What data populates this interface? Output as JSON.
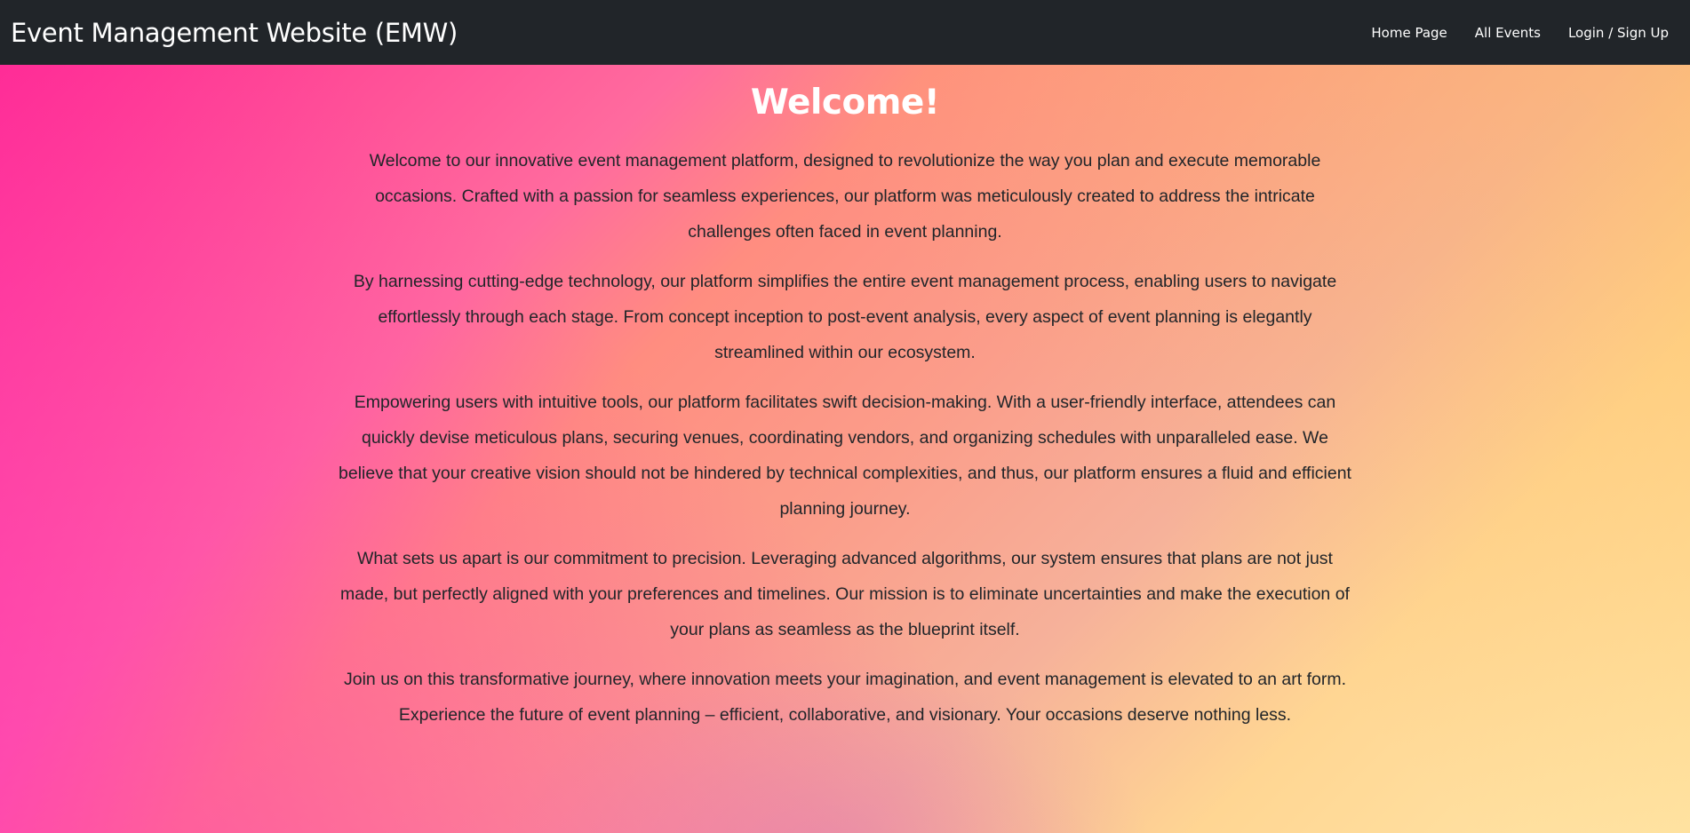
{
  "navbar": {
    "brand": "Event Management Website (EMW)",
    "links": [
      {
        "label": "Home Page"
      },
      {
        "label": "All Events"
      },
      {
        "label": "Login / Sign Up"
      }
    ],
    "background": "#212529"
  },
  "main": {
    "title": "Welcome!",
    "paragraphs": [
      "Welcome to our innovative event management platform, designed to revolutionize the way you plan and execute memorable occasions. Crafted with a passion for seamless experiences, our platform was meticulously created to address the intricate challenges often faced in event planning.",
      "By harnessing cutting-edge technology, our platform simplifies the entire event management process, enabling users to navigate effortlessly through each stage. From concept inception to post-event analysis, every aspect of event planning is elegantly streamlined within our ecosystem.",
      "Empowering users with intuitive tools, our platform facilitates swift decision-making. With a user-friendly interface, attendees can quickly devise meticulous plans, securing venues, coordinating vendors, and organizing schedules with unparalleled ease. We believe that your creative vision should not be hindered by technical complexities, and thus, our platform ensures a fluid and efficient planning journey.",
      "What sets us apart is our commitment to precision. Leveraging advanced algorithms, our system ensures that plans are not just made, but perfectly aligned with your preferences and timelines. Our mission is to eliminate uncertainties and make the execution of your plans as seamless as the blueprint itself.",
      "Join us on this transformative journey, where innovation meets your imagination, and event management is elevated to an art form. Experience the future of event planning – efficient, collaborative, and visionary. Your occasions deserve nothing less."
    ],
    "gradient_colors": [
      "#ff2d8f",
      "#ff8d80",
      "#ffd693",
      "#ffe6a8"
    ]
  }
}
